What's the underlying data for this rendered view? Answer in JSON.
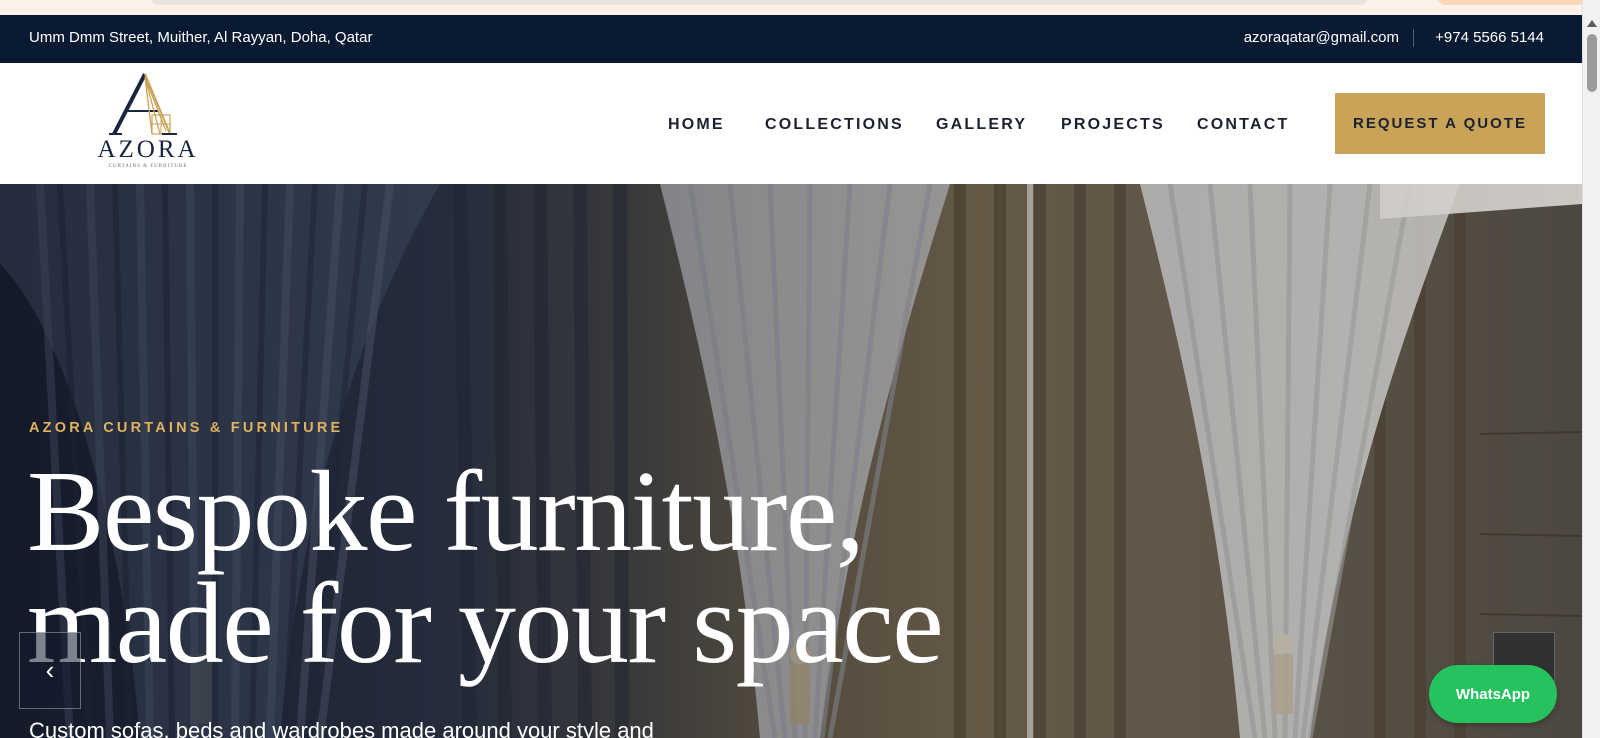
{
  "info_bar": {
    "address": "Umm Dmm Street, Muither, Al Rayyan, Doha, Qatar",
    "email": "azoraqatar@gmail.com",
    "phone": "+974 5566 5144"
  },
  "brand": {
    "wordmark": "AZORA",
    "tagline": "CURTAINS & FURNITURE"
  },
  "nav": {
    "home": "HOME",
    "collections": "COLLECTIONS",
    "gallery": "GALLERY",
    "projects": "PROJECTS",
    "contact": "CONTACT",
    "cta": "REQUEST A QUOTE"
  },
  "hero": {
    "eyebrow": "AZORA CURTAINS & FURNITURE",
    "headline_line1": "Bespoke furniture,",
    "headline_line2": "made for your space",
    "subtext": "Custom sofas, beds and wardrobes made around your style and",
    "prev_icon": "‹"
  },
  "floating": {
    "whatsapp": "WhatsApp"
  },
  "colors": {
    "topbar_bg": "#0b1a33",
    "accent_gold": "#c9a357",
    "eyebrow_gold": "#e0b25d",
    "whatsapp_green": "#25c25e"
  }
}
